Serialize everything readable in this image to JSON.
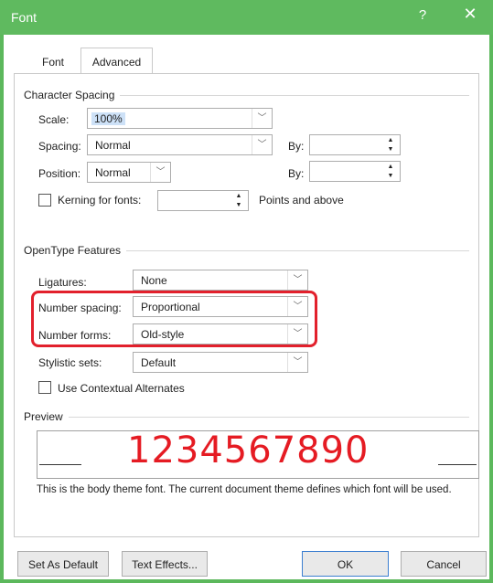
{
  "window": {
    "title": "Font",
    "help": "?",
    "close": "✕"
  },
  "tabs": {
    "font": "Font",
    "advanced": "Advanced"
  },
  "character_spacing": {
    "group": "Character Spacing",
    "scale_label": "Scale:",
    "scale_value": "100%",
    "spacing_label": "Spacing:",
    "spacing_value": "Normal",
    "by1_label": "By:",
    "by1_value": "",
    "position_label": "Position:",
    "position_value": "Normal",
    "by2_label": "By:",
    "by2_value": "",
    "kerning_label": "Kerning for fonts:",
    "kerning_value": "",
    "points_label": "Points and above"
  },
  "opentype": {
    "group": "OpenType Features",
    "ligatures_label": "Ligatures:",
    "ligatures_value": "None",
    "number_spacing_label": "Number spacing:",
    "number_spacing_value": "Proportional",
    "number_forms_label": "Number forms:",
    "number_forms_value": "Old-style",
    "stylistic_label": "Stylistic sets:",
    "stylistic_value": "Default",
    "contextual_label": "Use Contextual Alternates"
  },
  "preview": {
    "group": "Preview",
    "sample": "1234567890",
    "note": "This is the body theme font. The current document theme defines which font will be used."
  },
  "buttons": {
    "set_default": "Set As Default",
    "text_effects": "Text Effects...",
    "ok": "OK",
    "cancel": "Cancel"
  },
  "colors": {
    "titlebar": "#5fba5f",
    "highlight": "#e2202c",
    "preview_text": "#e51b23"
  }
}
